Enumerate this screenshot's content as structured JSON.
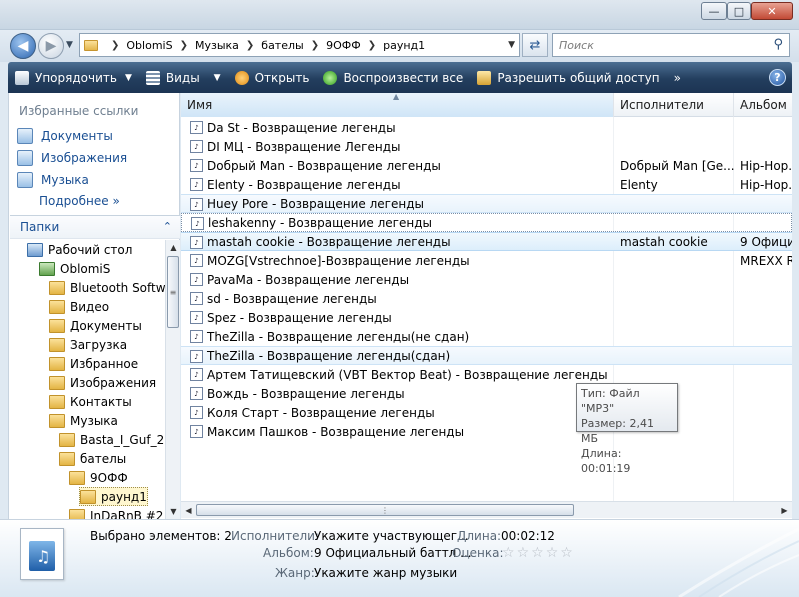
{
  "window": {
    "controls": [
      "—",
      "□",
      "✕"
    ]
  },
  "address": {
    "crumbs": [
      "OblomiS",
      "Музыка",
      "бателы",
      "9ОФФ",
      "раунд1"
    ],
    "search_placeholder": "Поиск"
  },
  "toolbar": {
    "organize": "Упорядочить",
    "views": "Виды",
    "open": "Открыть",
    "play_all": "Воспроизвести все",
    "share": "Разрешить общий доступ",
    "more": "»",
    "help": "?"
  },
  "nav": {
    "favorites_title": "Избранные ссылки",
    "favorites": [
      {
        "label": "Документы",
        "icon": "documents-icon"
      },
      {
        "label": "Изображения",
        "icon": "pictures-icon"
      },
      {
        "label": "Музыка",
        "icon": "music-icon"
      }
    ],
    "more": "Подробнее »",
    "folders_title": "Папки",
    "tree": [
      {
        "label": "Рабочий стол",
        "indent": 0,
        "icon": "desktop"
      },
      {
        "label": "OblomiS",
        "indent": 1,
        "icon": "user"
      },
      {
        "label": "Bluetooth Software",
        "indent": 2,
        "icon": "folder"
      },
      {
        "label": "Видео",
        "indent": 2,
        "icon": "video"
      },
      {
        "label": "Документы",
        "indent": 2,
        "icon": "documents"
      },
      {
        "label": "Загрузка",
        "indent": 2,
        "icon": "downloads"
      },
      {
        "label": "Избранное",
        "indent": 2,
        "icon": "favorites"
      },
      {
        "label": "Изображения",
        "indent": 2,
        "icon": "pictures"
      },
      {
        "label": "Контакты",
        "indent": 2,
        "icon": "contacts"
      },
      {
        "label": "Музыка",
        "indent": 2,
        "icon": "music"
      },
      {
        "label": "Basta_I_Guf_2010",
        "indent": 3,
        "icon": "folder"
      },
      {
        "label": "бателы",
        "indent": 3,
        "icon": "folder"
      },
      {
        "label": "9ОФФ",
        "indent": 4,
        "icon": "folder"
      },
      {
        "label": "раунд1",
        "indent": 5,
        "icon": "folder",
        "selected": true
      },
      {
        "label": "InDaRnB #2",
        "indent": 3,
        "icon": "folder"
      }
    ]
  },
  "files": {
    "columns": {
      "name": "Имя",
      "artist": "Исполнители",
      "album": "Альбом"
    },
    "rows": [
      {
        "name": "Da St - Возвращение легенды",
        "artist": "",
        "album": "",
        "state": ""
      },
      {
        "name": "DI МЦ - Возвращение Легенды",
        "artist": "",
        "album": "",
        "state": ""
      },
      {
        "name": "Dобрый Man - Возвращение легенды",
        "artist": "Dобрый Man [Ge...",
        "album": "Hip-Hop.R",
        "state": ""
      },
      {
        "name": "Elenty - Возвращение легенды",
        "artist": "Elenty",
        "album": "Hip-Hop.R",
        "state": ""
      },
      {
        "name": "Huey Pore - Возвращение легенды",
        "artist": "",
        "album": "",
        "state": "hl2"
      },
      {
        "name": "leshakenny - Возвращение легенды",
        "artist": "",
        "album": "",
        "state": "focus"
      },
      {
        "name": "mastah cookie - Возвращение легенды",
        "artist": "mastah cookie",
        "album": "9 Официа",
        "state": "hl"
      },
      {
        "name": "MOZG[Vstrechnoe]-Возвращение легенды",
        "artist": "",
        "album": "MREXX RE",
        "state": ""
      },
      {
        "name": "PavaMa - Возвращение легенды",
        "artist": "",
        "album": "",
        "state": ""
      },
      {
        "name": "sd - Возвращение легенды",
        "artist": "",
        "album": "",
        "state": ""
      },
      {
        "name": "Spez  - Возвращение легенды",
        "artist": "",
        "album": "",
        "state": ""
      },
      {
        "name": "TheZilla - Возвращение легенды(не сдан)",
        "artist": "",
        "album": "",
        "state": ""
      },
      {
        "name": "TheZilla - Возвращение легенды(сдан)",
        "artist": "",
        "album": "",
        "state": "hl2"
      },
      {
        "name": "Артем Татищевский (VBT Вектор Beat) - Возвращение легенды",
        "artist": "",
        "album": "",
        "state": ""
      },
      {
        "name": "Вождь - Возвращение  легенды",
        "artist": "",
        "album": "",
        "state": ""
      },
      {
        "name": "Коля Старт - Возвращение легенды",
        "artist": "",
        "album": "",
        "state": ""
      },
      {
        "name": "Максим Пашков - Возвращение легенды",
        "artist": "",
        "album": "",
        "state": ""
      }
    ],
    "tooltip": {
      "type": "Тип: Файл \"MP3\"",
      "size": "Размер: 2,41 МБ",
      "length": "Длина: 00:01:19"
    }
  },
  "details": {
    "selected": "Выбрано элементов: 2",
    "artist_label": "Исполнители:",
    "artist_value": "Укажите участвующег...",
    "length_label": "Длина:",
    "length_value": "00:02:12",
    "album_label": "Альбом:",
    "album_value": "9 Официальный баттл ...",
    "rating_label": "Оценка:",
    "rating_value": 0,
    "genre_label": "Жанр:",
    "genre_value": "Укажите жанр музыки"
  }
}
